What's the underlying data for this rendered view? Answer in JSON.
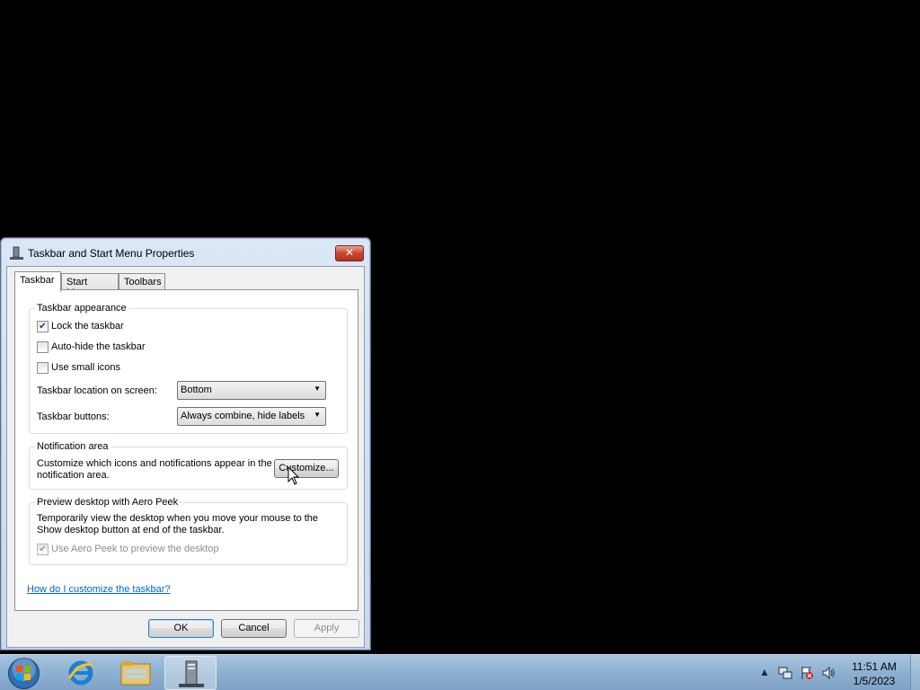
{
  "dialog": {
    "title": "Taskbar and Start Menu Properties",
    "close_label": "✕",
    "tabs": [
      {
        "label": "Taskbar"
      },
      {
        "label": "Start Menu"
      },
      {
        "label": "Toolbars"
      }
    ],
    "appearance": {
      "title": "Taskbar appearance",
      "lock_label": "Lock the taskbar",
      "lock_checked": true,
      "autohide_label": "Auto-hide the taskbar",
      "autohide_checked": false,
      "small_icons_label": "Use small icons",
      "small_icons_checked": false,
      "location_label": "Taskbar location on screen:",
      "location_value": "Bottom",
      "buttons_label": "Taskbar buttons:",
      "buttons_value": "Always combine, hide labels"
    },
    "notification": {
      "title": "Notification area",
      "description_line1": "Customize which icons and notifications appear in the",
      "description_line2": "notification area.",
      "customize_label": "Customize..."
    },
    "aero_peek": {
      "title": "Preview desktop with Aero Peek",
      "description_line1": "Temporarily view the desktop when you move your mouse to the",
      "description_line2": "Show desktop button at end of the taskbar.",
      "checkbox_label": "Use Aero Peek to preview the desktop",
      "checked": true,
      "disabled": true
    },
    "help_link": "How do I customize the taskbar?",
    "ok_label": "OK",
    "cancel_label": "Cancel",
    "apply_label": "Apply"
  },
  "taskbar": {
    "pinned": [
      "windows-start-icon",
      "internet-explorer-icon",
      "windows-explorer-icon",
      "server-manager-icon"
    ],
    "clock_time": "11:51 AM",
    "clock_date": "1/5/2023"
  }
}
